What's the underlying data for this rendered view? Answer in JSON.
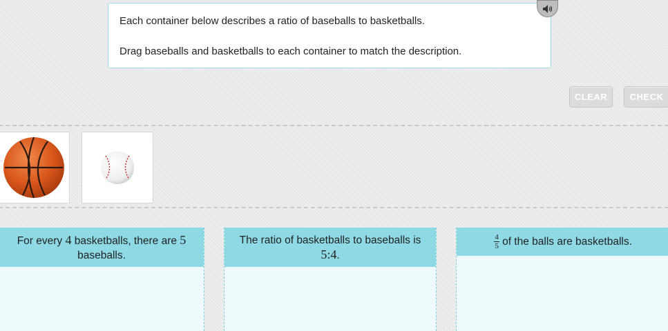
{
  "instructions": {
    "line1": "Each container below describes a ratio of baseballs to basketballs.",
    "line2": "Drag baseballs and basketballs to each container to match the description."
  },
  "speaker_icon": "speaker-icon",
  "buttons": {
    "clear": "CLEAR",
    "check": "CHECK"
  },
  "tray": {
    "items": [
      {
        "name": "basketball",
        "icon": "basketball-icon"
      },
      {
        "name": "baseball",
        "icon": "baseball-icon"
      }
    ]
  },
  "bins": [
    {
      "pre": "For every ",
      "n1": "4",
      "mid": " basketballs, there are ",
      "n2": "5",
      "post": " baseballs."
    },
    {
      "pre": "The ratio of basketballs to baseballs is ",
      "ratio": "5:4",
      "post": "."
    },
    {
      "frac_num": "4",
      "frac_den": "5",
      "post": " of the balls are basketballs."
    }
  ],
  "colors": {
    "bin_header": "#8fd9e4",
    "bin_body": "#eef9fb",
    "button": "#dcdcdc"
  }
}
